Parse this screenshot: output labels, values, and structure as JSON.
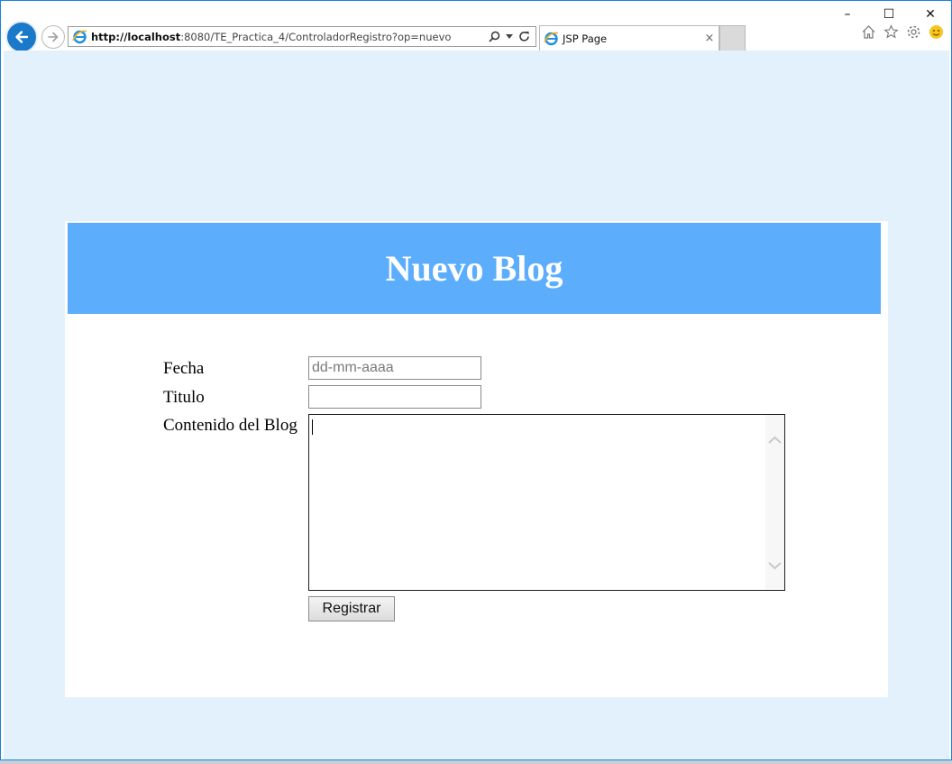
{
  "browser": {
    "url_host": "http://localhost",
    "url_rest": ":8080/TE_Practica_4/ControladorRegistro?op=nuevo",
    "tab_title": "JSP Page",
    "tab_close": "×",
    "window_minimize": "–",
    "window_maximize": "☐",
    "window_close": "✕"
  },
  "page": {
    "header_title": "Nuevo Blog",
    "form": {
      "fecha_label": "Fecha",
      "fecha_placeholder": "dd-mm-aaaa",
      "fecha_value": "",
      "titulo_label": "Titulo",
      "titulo_value": "",
      "contenido_label": "Contenido del Blog",
      "contenido_value": "",
      "submit_label": "Registrar"
    }
  },
  "colors": {
    "page_background": "#e3f1fc",
    "header_background": "#5caefc",
    "card_background": "#ffffff",
    "back_button": "#1a79c9"
  },
  "icons": {
    "back": "arrow-left-icon",
    "forward": "arrow-right-icon",
    "site": "ie-logo-icon",
    "search": "search-icon",
    "dropdown": "chevron-down-icon",
    "refresh": "refresh-icon",
    "home": "home-icon",
    "favorites": "star-icon",
    "settings": "gear-icon",
    "feedback": "smiley-icon"
  }
}
